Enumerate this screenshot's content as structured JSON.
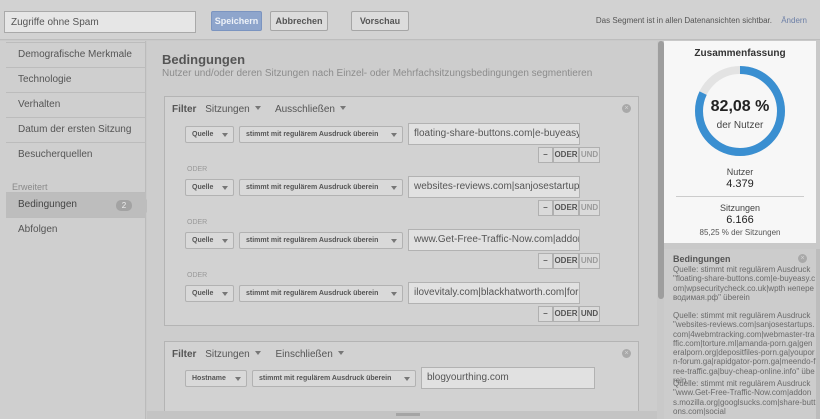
{
  "header": {
    "segment_name": "Zugriffe ohne Spam",
    "save_label": "Speichern",
    "cancel_label": "Abbrechen",
    "preview_label": "Vorschau",
    "visibility_note": "Das Segment ist in allen Datenansichten sichtbar.",
    "change_label": "Ändern"
  },
  "sidebar": {
    "items": [
      {
        "label": "Demografische Merkmale"
      },
      {
        "label": "Technologie"
      },
      {
        "label": "Verhalten"
      },
      {
        "label": "Datum der ersten Sitzung"
      },
      {
        "label": "Besucherquellen"
      }
    ],
    "advanced_caption": "Erweitert",
    "advanced_items": [
      {
        "label": "Bedingungen",
        "count": "2"
      },
      {
        "label": "Abfolgen"
      }
    ]
  },
  "main": {
    "title": "Bedingungen",
    "subtitle": "Nutzer und/oder deren Sitzungen nach Einzel- oder Mehrfachsitzungsbedingungen segmentieren",
    "filters": [
      {
        "label": "Filter",
        "scope": "Sitzungen",
        "mode": "Ausschließen",
        "conditions": [
          {
            "dimension": "Quelle",
            "operator": "stimmt mit regulärem Ausdruck überein",
            "value": "floating-share-buttons.com|e-buyeasy.cc"
          },
          {
            "dimension": "Quelle",
            "operator": "stimmt mit regulärem Ausdruck überein",
            "value": "websites-reviews.com|sanjosestartups.c"
          },
          {
            "dimension": "Quelle",
            "operator": "stimmt mit regulärem Ausdruck überein",
            "value": "www.Get-Free-Traffic-Now.com|addons."
          },
          {
            "dimension": "Quelle",
            "operator": "stimmt mit regulärem Ausdruck überein",
            "value": "ilovevitaly.com|blackhatworth.com|forum"
          }
        ]
      },
      {
        "label": "Filter",
        "scope": "Sitzungen",
        "mode": "Einschließen",
        "conditions": [
          {
            "dimension": "Hostname",
            "operator": "stimmt mit regulärem Ausdruck überein",
            "value": "blogyourthing.com"
          }
        ]
      }
    ],
    "or_label": "ODER",
    "and_label": "UND",
    "minus_label": "–"
  },
  "summary": {
    "title": "Zusammenfassung",
    "percent_text": "82,08 %",
    "percent_value": 82.08,
    "percent_caption": "der Nutzer",
    "users_label": "Nutzer",
    "users_value": "4.379",
    "sessions_label": "Sitzungen",
    "sessions_value": "6.166",
    "sessions_pct": "85,25 % der Sitzungen",
    "ring_color": "#3a8fd1",
    "ring_track_color": "#e3e3e3"
  },
  "conditions_panel": {
    "title": "Bedingungen",
    "entries": [
      "Quelle: stimmt mit regulärem Ausdruck \"floating-share-buttons.com|e-buyeasy.com|wpsecuritycheck.co.uk|wpth непереводимая.рф\" überein",
      "Quelle: stimmt mit regulärem Ausdruck \"websites-reviews.com|sanjosestartups.com|4webmtracking.com|webmaster-traffic.com|torture.ml|amanda-porn.ga|generalporn.org|depositfiles-porn.ga|youporn-forum.ga|rapidgator-porn.ga|meendo-free-traffic.ga|buy-cheap-online.info\" überein",
      "Quelle: stimmt mit regulärem Ausdruck \"www.Get-Free-Traffic-Now.com|addons.mozilla.org|googlsucks.com|share-buttons.com|social"
    ]
  }
}
